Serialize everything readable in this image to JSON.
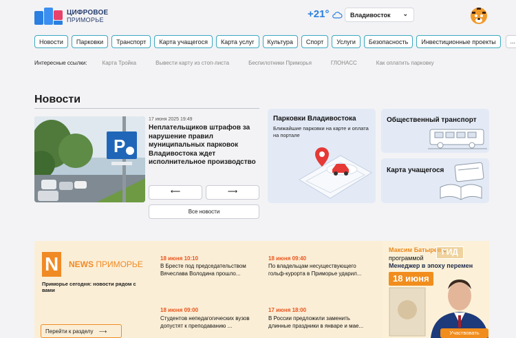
{
  "header": {
    "logo_line1": "ЦИФРОВОЕ",
    "logo_line2": "ПРИМОРЬЕ",
    "temperature": "+21°",
    "weather_icon": "cloud-icon",
    "city": "Владивосток"
  },
  "nav": {
    "items": [
      {
        "label": "Новости"
      },
      {
        "label": "Парковки"
      },
      {
        "label": "Транспорт"
      },
      {
        "label": "Карта учащегося"
      },
      {
        "label": "Карта услуг"
      },
      {
        "label": "Культура"
      },
      {
        "label": "Спорт"
      },
      {
        "label": "Услуги"
      },
      {
        "label": "Безопасность"
      },
      {
        "label": "Инвестиционные проекты"
      }
    ],
    "more": "..."
  },
  "links": {
    "label": "Интересные ссылки:",
    "items": [
      {
        "label": "Карта Тройка"
      },
      {
        "label": "Вывести карту из стоп-листа"
      },
      {
        "label": "Беспилотники Приморья"
      },
      {
        "label": "ГЛОНАСС"
      },
      {
        "label": "Как оплатить парковку"
      }
    ]
  },
  "news": {
    "title": "Новости",
    "date": "17 июня 2025 19:49",
    "headline": "Неплательщиков штрафов за нарушение правил муниципальных парковок Владивостока ждет исполнительное производство",
    "prev": "⟵",
    "next": "⟶",
    "all": "Все новости"
  },
  "tiles": {
    "parking_title": "Парковки Владивостока",
    "parking_sub": "Ближайшие парковки на карте и оплата на портале",
    "transport_title": "Общественный транспорт",
    "card_title": "Карта учащегося"
  },
  "news_banner": {
    "brand_news": "NEWS",
    "brand_region": "ПРИМОРЬЕ",
    "logo_letter": "N",
    "slogan": "Приморье сегодня: новости рядом с вами",
    "goto": "Перейти к разделу",
    "items": [
      {
        "date": "18 июня 10:10",
        "text": "В Бресте под председательством Вячеслава Володина прошло..."
      },
      {
        "date": "18 июня 09:40",
        "text": "По владельцам несуществующего гольф-курорта в Приморье ударил..."
      },
      {
        "date": "18 июня 09:00",
        "text": "Студентов непедагогических вузов допустят к преподаванию ..."
      },
      {
        "date": "17 июня 18:00",
        "text": "В России предложили заменить длинные праздники в январе и мае..."
      }
    ]
  },
  "gid_banner": {
    "name": "Максим Батырев",
    "with": "с",
    "program_word": "программой",
    "program": "Менеджер в эпоху перемен",
    "tag": "ГИД",
    "date": "18 июня",
    "cta": "Участвовать"
  },
  "colors": {
    "accent": "#2a7fe0",
    "nav_border": "#3aa8c0",
    "news_orange": "#e8541c",
    "gid_orange": "#f18d1d"
  }
}
